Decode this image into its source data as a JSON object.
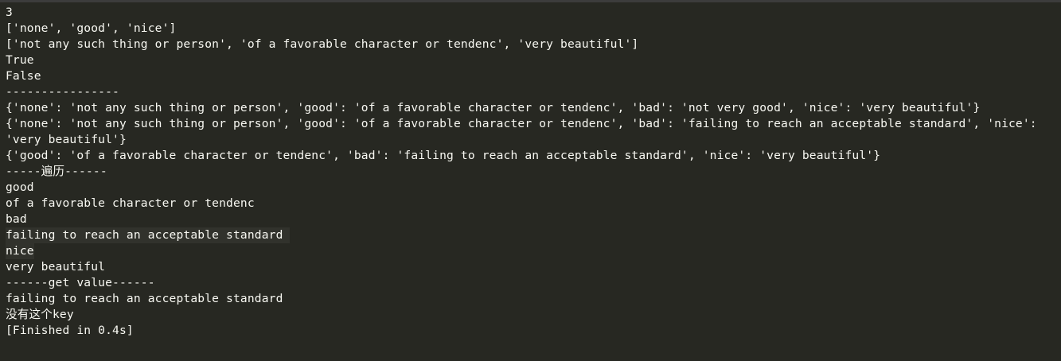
{
  "console": {
    "lines": [
      "3",
      "['none', 'good', 'nice']",
      "['not any such thing or person', 'of a favorable character or tendenc', 'very beautiful']",
      "True",
      "False",
      "----------------",
      "{'none': 'not any such thing or person', 'good': 'of a favorable character or tendenc', 'bad': 'not very good', 'nice': 'very beautiful'}",
      "{'none': 'not any such thing or person', 'good': 'of a favorable character or tendenc', 'bad': 'failing to reach an acceptable standard', 'nice':",
      "'very beautiful'}",
      "{'good': 'of a favorable character or tendenc', 'bad': 'failing to reach an acceptable standard', 'nice': 'very beautiful'}",
      "-----遍历------",
      "good",
      "of a favorable character or tendenc",
      "bad",
      "failing to reach an acceptable standard",
      "nice",
      "very beautiful",
      "------get value------",
      "failing to reach an acceptable standard",
      "没有这个key",
      "[Finished in 0.4s]"
    ]
  },
  "colors": {
    "background": "#272822",
    "text": "#f8f8f2",
    "highlight": "#31322c",
    "top_border": "#3c3c3c"
  }
}
